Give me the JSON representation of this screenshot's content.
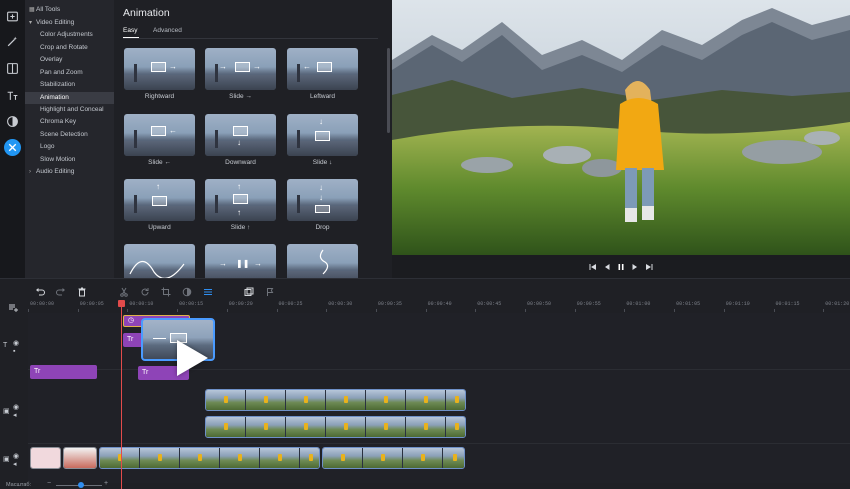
{
  "theme": {
    "accent": "#2196f3",
    "title_clip": "#8e44b7",
    "playhead": "#e24b4b",
    "selection": "#4a9bff"
  },
  "rail_icons": [
    "import-icon",
    "magic-wand-icon",
    "filters-icon",
    "titles-icon",
    "transitions-icon",
    "more-tools-icon"
  ],
  "tools_tree": {
    "items": [
      {
        "label": "All Tools",
        "level": 0,
        "icon": "grid-icon"
      },
      {
        "label": "Video Editing",
        "level": 0,
        "icon": "chevron-down-icon",
        "expanded": true
      },
      {
        "label": "Color Adjustments",
        "level": 1
      },
      {
        "label": "Crop and Rotate",
        "level": 1
      },
      {
        "label": "Overlay",
        "level": 1
      },
      {
        "label": "Pan and Zoom",
        "level": 1
      },
      {
        "label": "Stabilization",
        "level": 1
      },
      {
        "label": "Animation",
        "level": 1,
        "selected": true
      },
      {
        "label": "Highlight and Conceal",
        "level": 1
      },
      {
        "label": "Chroma Key",
        "level": 1
      },
      {
        "label": "Scene Detection",
        "level": 1
      },
      {
        "label": "Logo",
        "level": 1
      },
      {
        "label": "Slow Motion",
        "level": 1
      },
      {
        "label": "Audio Editing",
        "level": 0,
        "icon": "chevron-right-icon",
        "expanded": false
      }
    ]
  },
  "animation_panel": {
    "title": "Animation",
    "tabs": [
      {
        "label": "Easy",
        "active": true
      },
      {
        "label": "Advanced",
        "active": false
      }
    ],
    "presets": [
      {
        "label": "Rightward",
        "icon": "arrow-right-icon"
      },
      {
        "label": "Slide →",
        "icon": "slide-right-icon"
      },
      {
        "label": "Leftward",
        "icon": "arrow-left-icon"
      },
      {
        "label": "Slide ←",
        "icon": "slide-left-icon"
      },
      {
        "label": "Downward",
        "icon": "arrow-down-icon"
      },
      {
        "label": "Slide ↓",
        "icon": "slide-down-icon"
      },
      {
        "label": "Upward",
        "icon": "arrow-up-icon"
      },
      {
        "label": "Slide ↑",
        "icon": "slide-up-icon"
      },
      {
        "label": "Drop",
        "icon": "drop-icon"
      },
      {
        "label": "",
        "icon": "curve-icon"
      },
      {
        "label": "",
        "icon": "pause-slide-icon"
      },
      {
        "label": "",
        "icon": "bounce-icon"
      }
    ]
  },
  "player": {
    "controls": [
      "skip-back-icon",
      "frame-back-icon",
      "pause-icon",
      "frame-forward-icon",
      "skip-forward-icon"
    ]
  },
  "timeline": {
    "toolbar_icons": [
      "add-track-icon",
      "undo-icon",
      "redo-icon",
      "delete-icon",
      "cut-icon",
      "rotate-icon",
      "crop-icon",
      "color-icon",
      "levels-icon",
      "snapshot-icon",
      "marker-icon"
    ],
    "ruler": [
      "00:00:00",
      "00:00:05",
      "00:00:10",
      "00:00:15",
      "00:00:20",
      "00:00:25",
      "00:00:30",
      "00:00:35",
      "00:00:40",
      "00:00:45",
      "00:00:50",
      "00:00:55",
      "00:01:00",
      "00:01:05",
      "00:01:10",
      "00:01:15",
      "00:01:20"
    ],
    "title_clips": [
      {
        "label": "Tr"
      },
      {
        "label": "Tr"
      },
      {
        "label": "Tr"
      },
      {
        "label": "Tr"
      }
    ],
    "zoom_label": "Масштаб:"
  }
}
